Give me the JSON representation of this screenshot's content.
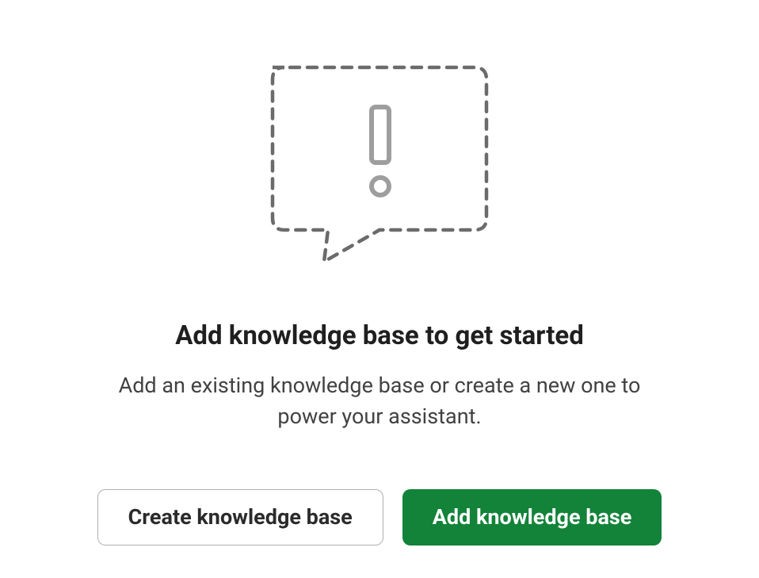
{
  "empty_state": {
    "heading": "Add knowledge base to get started",
    "subheading": "Add an existing knowledge base or create a new one to power your assistant.",
    "buttons": {
      "create_label": "Create knowledge base",
      "add_label": "Add knowledge base"
    },
    "colors": {
      "primary_button_bg": "#128339",
      "primary_button_text": "#ffffff",
      "secondary_button_border": "#b0b0b0",
      "heading_color": "#1f1f1f",
      "subheading_color": "#424242"
    },
    "icon": "speech-bubble-exclamation"
  }
}
